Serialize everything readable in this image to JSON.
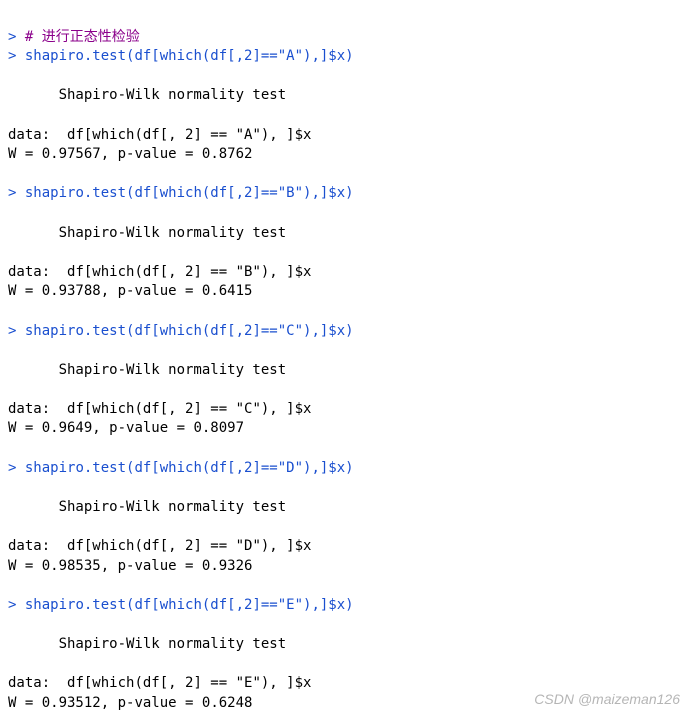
{
  "prompt_char": ">",
  "comment_prefix": "#",
  "comment_text": "进行正态性检验",
  "test_title": "Shapiro-Wilk normality test",
  "data_label": "data:",
  "tests": [
    {
      "command": "shapiro.test(df[which(df[,2]==\"A\"),]$x)",
      "data_expr": "df[which(df[, 2] == \"A\"), ]$x",
      "w": "0.97567",
      "pvalue": "0.8762"
    },
    {
      "command": "shapiro.test(df[which(df[,2]==\"B\"),]$x)",
      "data_expr": "df[which(df[, 2] == \"B\"), ]$x",
      "w": "0.93788",
      "pvalue": "0.6415"
    },
    {
      "command": "shapiro.test(df[which(df[,2]==\"C\"),]$x)",
      "data_expr": "df[which(df[, 2] == \"C\"), ]$x",
      "w": "0.9649",
      "pvalue": "0.8097"
    },
    {
      "command": "shapiro.test(df[which(df[,2]==\"D\"),]$x)",
      "data_expr": "df[which(df[, 2] == \"D\"), ]$x",
      "w": "0.98535",
      "pvalue": "0.9326"
    },
    {
      "command": "shapiro.test(df[which(df[,2]==\"E\"),]$x)",
      "data_expr": "df[which(df[, 2] == \"E\"), ]$x",
      "w": "0.93512",
      "pvalue": "0.6248"
    }
  ],
  "watermark": "CSDN @maizeman126"
}
